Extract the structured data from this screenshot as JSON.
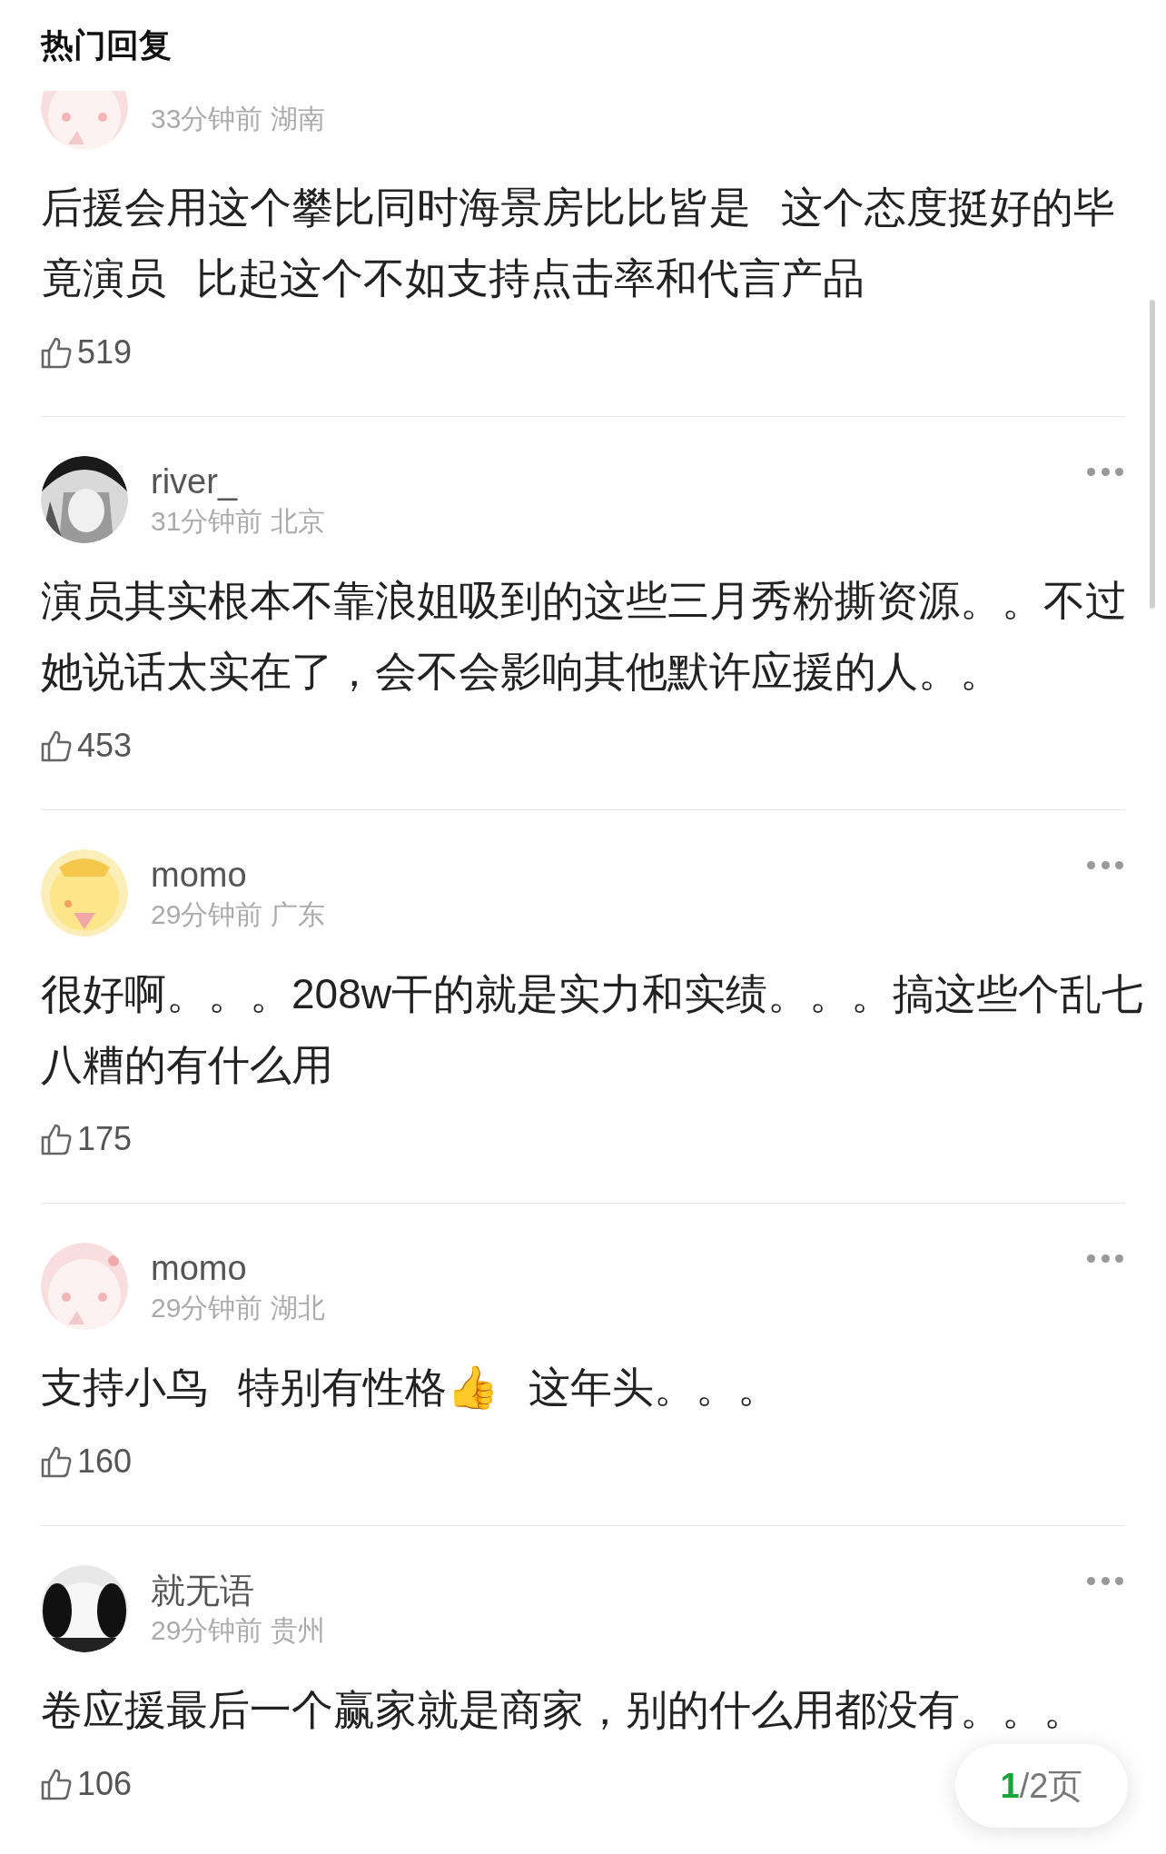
{
  "header": {
    "title": "热门回复"
  },
  "comments": [
    {
      "meta": "33分钟前 湖南",
      "text": "后援会用这个攀比同时海景房比比皆是 这个态度挺好的毕竟演员 比起这个不如支持点击率和代言产品",
      "likes": "519"
    },
    {
      "name": "river_",
      "meta": "31分钟前 北京",
      "text": "演员其实根本不靠浪姐吸到的这些三月秀粉撕资源。。不过她说话太实在了，会不会影响其他默许应援的人。。",
      "likes": "453"
    },
    {
      "name": "momo",
      "meta": "29分钟前 广东",
      "text": "很好啊。。。208w干的就是实力和实绩。。。搞这些个乱七八糟的有什么用",
      "likes": "175"
    },
    {
      "name": "momo",
      "meta": "29分钟前 湖北",
      "text": "支持小鸟 特别有性格👍 这年头。。。",
      "likes": "160"
    },
    {
      "name": "就无语",
      "meta": "29分钟前 贵州",
      "text": "卷应援最后一个赢家就是商家，别的什么用都没有。。。",
      "likes": "106"
    }
  ],
  "pager": {
    "current": "1",
    "total": "/2页"
  }
}
